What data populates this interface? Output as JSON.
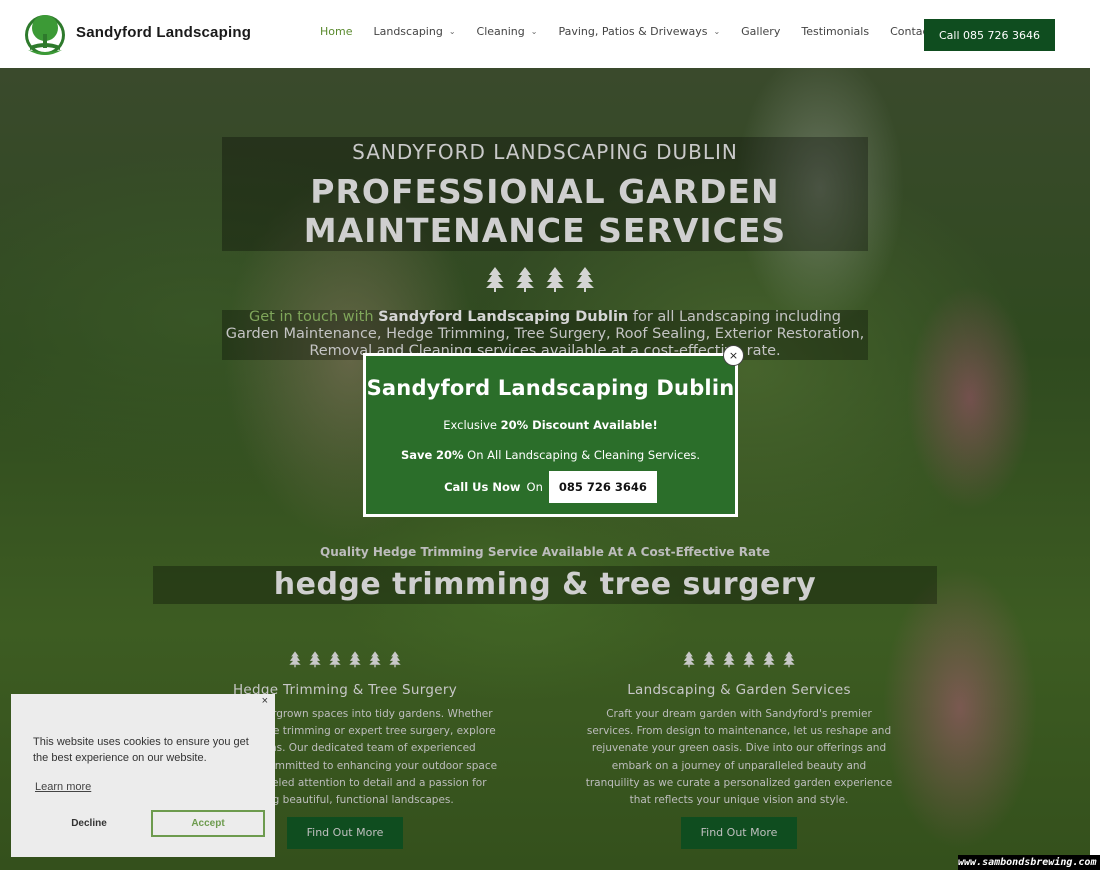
{
  "header": {
    "brand": "Sandyford Landscaping",
    "nav": [
      {
        "label": "Home",
        "dropdown": false,
        "active": true
      },
      {
        "label": "Landscaping",
        "dropdown": true,
        "active": false
      },
      {
        "label": "Cleaning",
        "dropdown": true,
        "active": false
      },
      {
        "label": "Paving, Patios & Driveways",
        "dropdown": true,
        "active": false
      },
      {
        "label": "Gallery",
        "dropdown": false,
        "active": false
      },
      {
        "label": "Testimonials",
        "dropdown": false,
        "active": false
      },
      {
        "label": "Contact",
        "dropdown": false,
        "active": false
      }
    ],
    "call_label": "Call 085 726 3646"
  },
  "hero": {
    "subtitle": "SANDYFORD LANDSCAPING DUBLIN",
    "title_line1": "PROFESSIONAL GARDEN",
    "title_line2": "MAINTENANCE SERVICES",
    "intro_highlight": "Get in touch with",
    "intro_bold": "Sandyford Landscaping Dublin",
    "intro_rest": "for all Landscaping including Garden Maintenance, Hedge Trimming, Tree Surgery, Roof Sealing, Exterior Restoration, Removal and Cleaning services available at a cost-effective rate.",
    "tagline": "Quality Hedge Trimming Service Available At A Cost-Effective Rate",
    "section_title": "hedge trimming & tree surgery"
  },
  "columns": [
    {
      "title": "Hedge Trimming & Tree Surgery",
      "text": "Transform overgrown spaces into tidy gardens. Whether you need hedge trimming or expert tree surgery, explore our solutions. Our dedicated team of experienced specialists is committed to enhancing your outdoor space with unparalleled attention to detail and a passion for creating beautiful, functional landscapes.",
      "button": "Find Out More"
    },
    {
      "title": "Landscaping & Garden Services",
      "text": "Craft your dream garden with Sandyford's premier services. From design to maintenance, let us reshape and rejuvenate your green oasis. Dive into our offerings and embark on a journey of unparalleled beauty and tranquility as we curate a personalized garden experience that reflects your unique vision and style.",
      "button": "Find Out More"
    }
  ],
  "popup": {
    "title": "Sandyford Landscaping Dublin",
    "line1_pre": "Exclusive",
    "line1_bold": "20% Discount Available!",
    "line2_bold1": "Save",
    "line2_bold2": "20%",
    "line2_rest": "On All Landscaping & Cleaning Services.",
    "call_bold": "Call Us Now",
    "call_rest": "On",
    "phone": "085 726 3646",
    "close": "×"
  },
  "cookie": {
    "close": "×",
    "text": "This website uses cookies to ensure you get the best experience on our website.",
    "learn_more": "Learn more",
    "decline": "Decline",
    "accept": "Accept"
  },
  "watermark": "www.sambondsbrewing.com",
  "colors": {
    "brand_green": "#0f4d1f",
    "popup_green": "#2b6e2a",
    "nav_active": "#5a8a2e",
    "accept_green": "#6d9b4e"
  }
}
